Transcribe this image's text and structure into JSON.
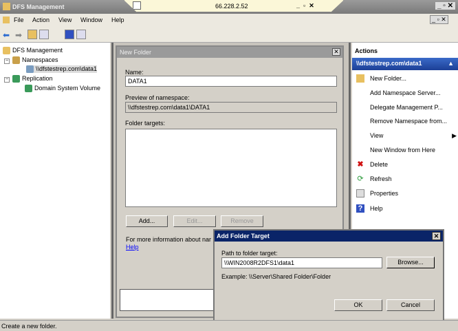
{
  "window": {
    "title": "DFS Management",
    "rdp_address": "66.228.2.52"
  },
  "menu": [
    "File",
    "Action",
    "View",
    "Window",
    "Help"
  ],
  "tree": {
    "root": "DFS Management",
    "namespaces": "Namespaces",
    "namespace_item": "\\\\dfstestrep.com\\data1",
    "replication": "Replication",
    "replication_item": "Domain System Volume"
  },
  "new_folder": {
    "title": "New Folder",
    "name_label": "Name:",
    "name_value": "DATA1",
    "preview_label": "Preview of namespace:",
    "preview_value": "\\\\dfstestrep.com\\data1\\DATA1",
    "targets_label": "Folder targets:",
    "add": "Add...",
    "edit": "Edit...",
    "remove": "Remove",
    "info_text": "For more information about nar",
    "help_link": "Help"
  },
  "actions": {
    "header": "Actions",
    "section": "\\\\dfstestrep.com\\data1",
    "items": [
      "New Folder...",
      "Add Namespace Server...",
      "Delegate Management P...",
      "Remove Namespace from...",
      "View",
      "New Window from Here",
      "Delete",
      "Refresh",
      "Properties",
      "Help"
    ]
  },
  "add_target": {
    "title": "Add Folder Target",
    "path_label": "Path to folder target:",
    "path_value": "\\\\WIN2008R2DFS1\\data1",
    "browse": "Browse...",
    "example": "Example: \\\\Server\\Shared Folder\\Folder",
    "ok": "OK",
    "cancel": "Cancel"
  },
  "status": "Create a new folder."
}
